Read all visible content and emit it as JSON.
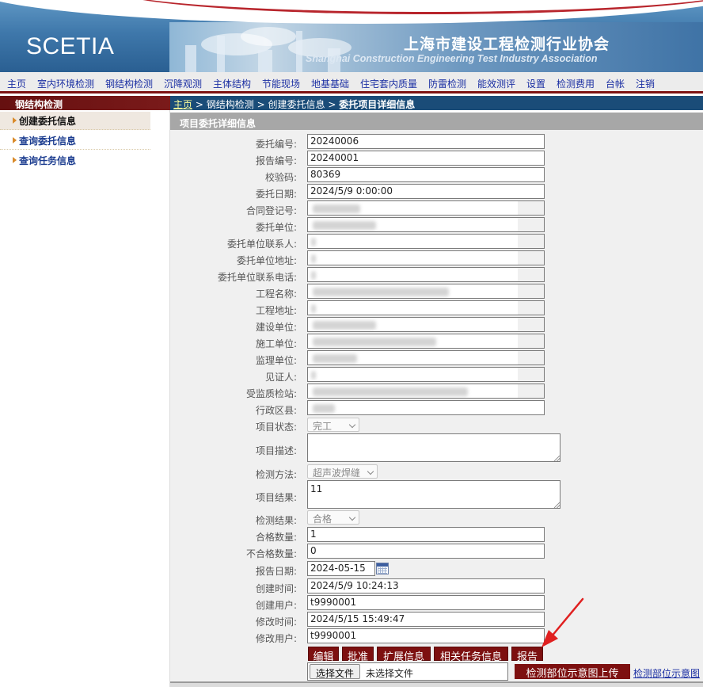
{
  "banner": {
    "logo_text": "SCETIA",
    "org_name_cn": "上海市建设工程检测行业协会",
    "org_name_en": "Shanghai Construction Engineering Test Industry Association"
  },
  "nav": {
    "items": [
      "主页",
      "室内环境检测",
      "钢结构检测",
      "沉降观测",
      "主体结构",
      "节能现场",
      "地基基础",
      "住宅套内质量",
      "防雷检测",
      "能效测评",
      "设置",
      "检测费用",
      "台帐",
      "注销"
    ]
  },
  "sidebar": {
    "title": "钢结构检测",
    "items": [
      "创建委托信息",
      "查询委托信息",
      "查询任务信息"
    ]
  },
  "breadcrumb": {
    "home": "主页",
    "sep": ">",
    "level1": "钢结构检测",
    "level2": "创建委托信息",
    "current": "委托项目详细信息"
  },
  "section_title": "项目委托详细信息",
  "form": {
    "entrust_no": {
      "label": "委托编号:",
      "value": "20240006"
    },
    "report_no": {
      "label": "报告编号:",
      "value": "20240001"
    },
    "check_code": {
      "label": "校验码:",
      "value": "80369"
    },
    "entrust_date": {
      "label": "委托日期:",
      "value": "2024/5/9 0:00:00"
    },
    "contract_no": {
      "label": "合同登记号:"
    },
    "entrust_unit": {
      "label": "委托单位:"
    },
    "entrust_contact": {
      "label": "委托单位联系人:"
    },
    "entrust_address": {
      "label": "委托单位地址:"
    },
    "entrust_phone": {
      "label": "委托单位联系电话:"
    },
    "project_name": {
      "label": "工程名称:"
    },
    "project_address": {
      "label": "工程地址:"
    },
    "build_unit": {
      "label": "建设单位:"
    },
    "construction_unit": {
      "label": "施工单位:"
    },
    "supervision_unit": {
      "label": "监理单位:"
    },
    "witness": {
      "label": "见证人:"
    },
    "quality_station": {
      "label": "受监质检站:"
    },
    "district": {
      "label": "行政区县:"
    },
    "project_status": {
      "label": "项目状态:",
      "value": "完工"
    },
    "project_desc": {
      "label": "项目描述:",
      "value": ""
    },
    "test_method": {
      "label": "检测方法:",
      "value": "超声波焊缝"
    },
    "project_conclusion": {
      "label": "项目结果:",
      "value": "11"
    },
    "test_result": {
      "label": "检测结果:",
      "value": "合格"
    },
    "qualified_count": {
      "label": "合格数量:",
      "value": "1"
    },
    "unqualified_count": {
      "label": "不合格数量:",
      "value": "0"
    },
    "report_date": {
      "label": "报告日期:",
      "value": "2024-05-15"
    },
    "created_time": {
      "label": "创建时间:",
      "value": "2024/5/9 10:24:13"
    },
    "created_user": {
      "label": "创建用户:",
      "value": "t9990001"
    },
    "modified_time": {
      "label": "修改时间:",
      "value": "2024/5/15 15:49:47"
    },
    "modified_user": {
      "label": "修改用户:",
      "value": "t9990001"
    }
  },
  "actions": {
    "edit": "编辑",
    "approve": "批准",
    "extend_info": "扩展信息",
    "related_tasks": "相关任务信息",
    "report": "报告"
  },
  "upload": {
    "choose_file": "选择文件",
    "no_file": "未选择文件",
    "upload_button": "检测部位示意图上传",
    "diagram_link": "检测部位示意图"
  },
  "colors": {
    "nav_text": "#1b2fa3",
    "brand_dark_red": "#7d1010",
    "breadcrumb_bg": "#1a4c78",
    "arrow": "#e02020"
  },
  "icons": {
    "calendar": "calendar-icon",
    "arrow": "red-arrow-annotation"
  }
}
